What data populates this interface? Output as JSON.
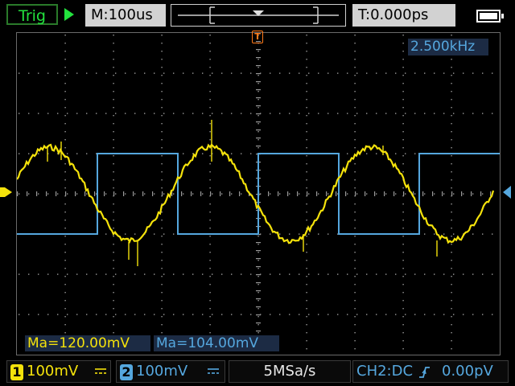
{
  "header": {
    "trigger_label": "Trig",
    "run_state_icon": "play-icon",
    "timebase": "M:100us",
    "trigger_time": "T:0.000ps",
    "battery_icon": "battery-icon"
  },
  "trigger_marker_glyph": "T",
  "frequency": "2.500kHz",
  "measurements": {
    "ch1": "Ma=120.00mV",
    "ch2": "Ma=104.00mV"
  },
  "footer": {
    "ch1": {
      "num": "1",
      "scale": "100mV",
      "coupling_icon": "dc-coupling-icon"
    },
    "ch2": {
      "num": "2",
      "scale": "100mV",
      "coupling_icon": "dc-coupling-icon"
    },
    "sample_rate": "5MSa/s",
    "trigger_info": {
      "source": "CH2:DC",
      "level": "0.00pV",
      "slope_icon": "rising-edge-icon"
    }
  },
  "colors": {
    "ch1": "#f4e20b",
    "ch2": "#55a7de",
    "trigger_marker": "#ff7a1a",
    "grid": "#9a9a9a",
    "run_indicator": "#23e23e"
  }
}
